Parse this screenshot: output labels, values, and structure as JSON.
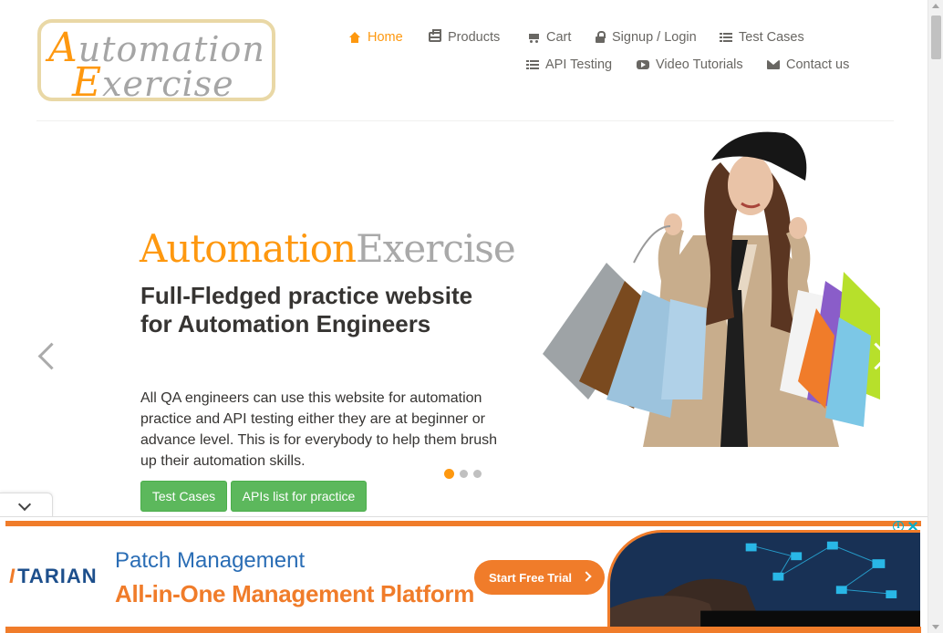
{
  "logo": {
    "line1_cap": "A",
    "line1_rest": "utomation",
    "line2_cap": "E",
    "line2_rest": "xercise"
  },
  "nav": {
    "items": [
      {
        "label": "Home",
        "icon": "home-icon",
        "active": true
      },
      {
        "label": "Products",
        "icon": "products-icon"
      },
      {
        "label": "Cart",
        "icon": "cart-icon"
      },
      {
        "label": "Signup / Login",
        "icon": "lock-icon"
      },
      {
        "label": "Test Cases",
        "icon": "list-icon"
      },
      {
        "label": "API Testing",
        "icon": "list-icon"
      },
      {
        "label": "Video Tutorials",
        "icon": "video-icon"
      },
      {
        "label": "Contact us",
        "icon": "envelope-icon"
      }
    ]
  },
  "slider": {
    "brand_part1": "Automation",
    "brand_part2": "Exercise",
    "headline": "Full-Fledged practice website for Automation Engineers",
    "description": "All QA engineers can use this website for automation practice and API testing either they are at beginner or advance level. This is for everybody to help them brush up their automation skills.",
    "button_test_cases": "Test Cases",
    "button_apis": "APIs list for practice",
    "slide_count": 3,
    "active_slide": 1
  },
  "ad": {
    "logo_text": "TARIAN",
    "logo_mark": "I",
    "title_line1": "Patch Management",
    "title_line2": "All-in-One Management Platform",
    "cta": "Start Free Trial",
    "info_glyph": "i"
  },
  "colors": {
    "accent": "#fe980f",
    "button_green": "#5cb85c",
    "ad_orange": "#f07c2a",
    "ad_blue": "#2a6db5"
  }
}
